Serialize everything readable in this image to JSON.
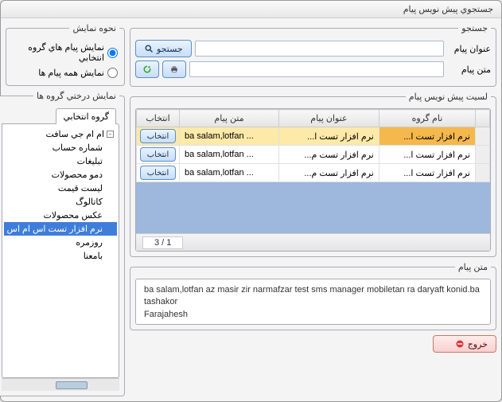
{
  "window": {
    "title": "جستجوي پيش نويس پيام"
  },
  "displayMode": {
    "legend": "نحوه نمايش",
    "opt1": "نمايش پيام هاي گروه انتخابي",
    "opt2": "نمايش همه پيام ها",
    "selected": 1
  },
  "tree": {
    "legend": "نمايش درختي گروه ها",
    "tab": "گروه انتخابي",
    "root": "ام ام جي سافت",
    "items": [
      "شماره حساب",
      "تبليغات",
      "دمو محصولات",
      "ليست قيمت",
      "كاتالوگ",
      "عكس محصولات",
      "نرم افزار تست اس ام اس",
      "روزمره",
      "بامعنا"
    ],
    "selected": "نرم افزار تست اس ام اس"
  },
  "search": {
    "legend": "جستجو",
    "label_title": "عنوان پيام",
    "label_text": "متن پيام",
    "btn_search": "جستجو"
  },
  "grid": {
    "legend": "لسيت پيش نويس پيام",
    "col_group": "نام گروه",
    "col_title": "عنوان پيام",
    "col_text": "متن پيام",
    "col_select": "انتخاب",
    "btn_select": "انتخاب",
    "pager": "1 / 3",
    "rows": [
      {
        "group": "نرم افزار تست ا...",
        "title": "نرم افزار تست ا...",
        "text": "ba salam,lotfan ...",
        "sel": true
      },
      {
        "group": "نرم افزار تست ا...",
        "title": "نرم افزار تست م...",
        "text": "ba salam,lotfan ...",
        "sel": false
      },
      {
        "group": "نرم افزار تست ا...",
        "title": "نرم افزار تست م...",
        "text": "ba salam,lotfan ...",
        "sel": false
      }
    ]
  },
  "message": {
    "legend": "متن پيام",
    "text": "ba salam,lotfan az masir zir narmafzar test sms manager mobiletan ra daryaft konid.ba tashakor\nFarajahesh"
  },
  "footer": {
    "exit": "خروج"
  }
}
